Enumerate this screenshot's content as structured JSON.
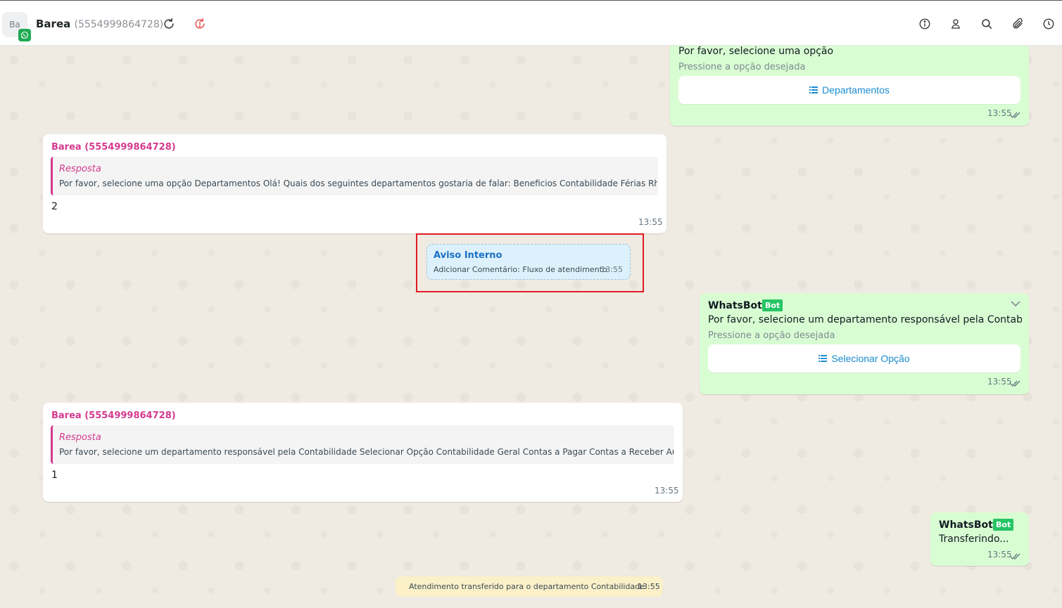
{
  "header": {
    "avatar_initials": "Ba",
    "contact_name": "Barea",
    "contact_number": "(5554999864728)",
    "icons": [
      "refresh-icon",
      "refresh-alert-icon",
      "info-icon",
      "user-icon",
      "search-icon",
      "paperclip-icon",
      "clock-icon"
    ]
  },
  "messages": {
    "m1": {
      "line1": "Por favor, selecione uma opção",
      "sub": "Pressione a opção desejada",
      "button": "Departamentos",
      "time": "13:55"
    },
    "m2": {
      "sender": "Barea (5554999864728)",
      "quote_title": "Resposta",
      "quote_body": "Por favor, selecione uma opção Departamentos Olá! Quais dos seguintes departamentos gostaria de falar: Beneficios Contabilidade Férias Rh Supervisão T.i",
      "text": "2",
      "time": "13:55"
    },
    "notice": {
      "title": "Aviso Interno",
      "text": "Adicionar Comentário: Fluxo de atendimento",
      "time": "13:55"
    },
    "m3": {
      "bot_name": "WhatsBot 1",
      "badge": "Bot",
      "line1": "Por favor, selecione um departamento responsável pela Contabilidade",
      "sub": "Pressione a opção desejada",
      "button": "Selecionar Opção",
      "time": "13:55"
    },
    "m4": {
      "sender": "Barea (5554999864728)",
      "quote_title": "Resposta",
      "quote_body": "Por favor, selecione um departamento responsável pela Contabilidade Selecionar Opção Contabilidade Geral Contas a Pagar Contas a Receber Auditoria Interna",
      "text": "1",
      "time": "13:55"
    },
    "m5": {
      "bot_name": "WhatsBot 1",
      "badge": "Bot",
      "line1": "Transferindo...",
      "time": "13:55"
    },
    "system": {
      "text": "Atendimento transferido para o departamento Contabilidade",
      "time": "13:55"
    }
  },
  "colors": {
    "outgoing_bubble": "#d9fdd3",
    "incoming_bubble": "#ffffff",
    "sender_name": "#d53a8f",
    "bot_badge": "#25c565",
    "link_blue": "#1a8ccf",
    "highlight_red": "#e01b24"
  }
}
